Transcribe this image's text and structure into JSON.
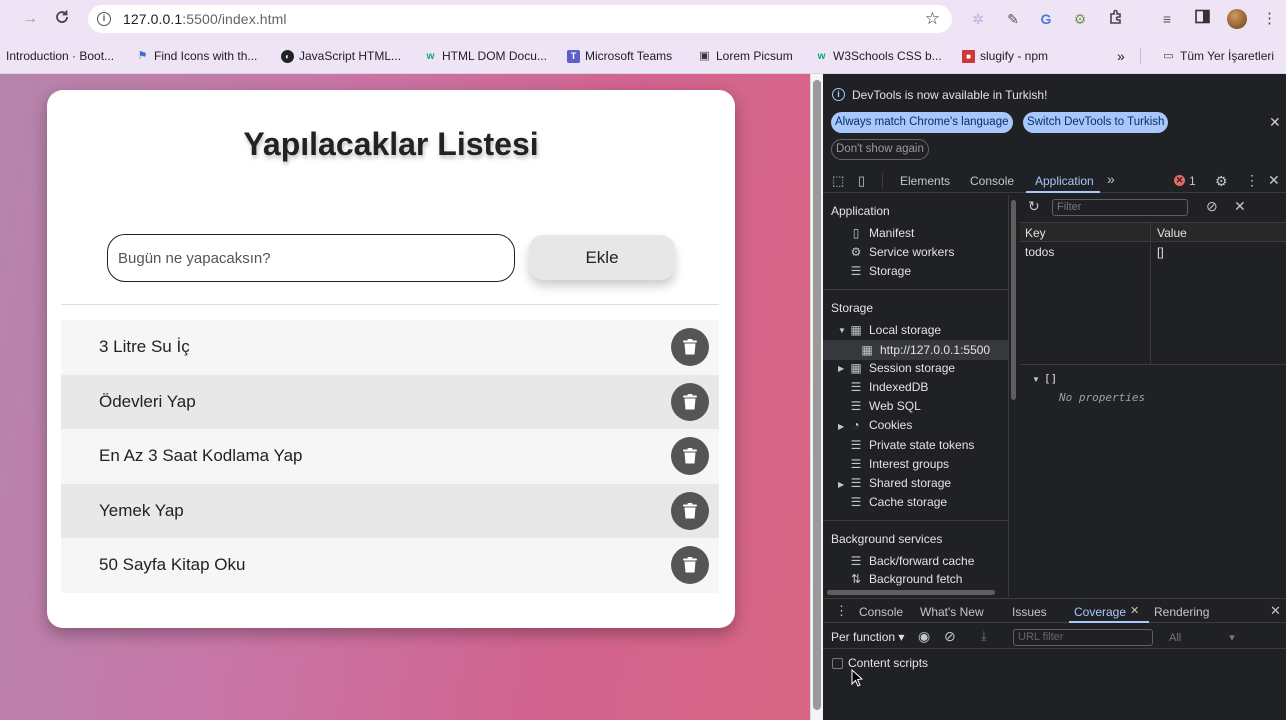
{
  "browser": {
    "url_host": "127.0.0.1",
    "url_rest": ":5500/index.html",
    "bookmarks": [
      {
        "label": "Introduction · Boot..."
      },
      {
        "label": "Find Icons with th..."
      },
      {
        "label": "JavaScript HTML..."
      },
      {
        "label": "HTML DOM Docu..."
      },
      {
        "label": "Microsoft Teams"
      },
      {
        "label": "Lorem Picsum"
      },
      {
        "label": "W3Schools CSS b..."
      },
      {
        "label": "slugify - npm"
      }
    ],
    "more_bookmarks": "»",
    "all_bookmarks": "Tüm Yer İşaretleri"
  },
  "app": {
    "title": "Yapılacaklar Listesi",
    "input_placeholder": "Bugün ne yapacaksın?",
    "add_label": "Ekle",
    "todos": [
      {
        "text": "3 Litre Su İç"
      },
      {
        "text": "Ödevleri Yap"
      },
      {
        "text": "En Az 3 Saat Kodlama Yap"
      },
      {
        "text": "Yemek Yap"
      },
      {
        "text": "50 Sayfa Kitap Oku"
      }
    ]
  },
  "devtools": {
    "banner": {
      "message": "DevTools is now available in Turkish!",
      "match_label": "Always match Chrome's language",
      "switch_label": "Switch DevTools to Turkish",
      "dont_show_label": "Don't show again"
    },
    "tabs": {
      "elements": "Elements",
      "console": "Console",
      "application": "Application",
      "more": "»",
      "error_count": "1"
    },
    "sidebar": {
      "application_header": "Application",
      "manifest": "Manifest",
      "service_workers": "Service workers",
      "storage_item": "Storage",
      "storage_header": "Storage",
      "local_storage": "Local storage",
      "local_origin": "http://127.0.0.1:5500",
      "session_storage": "Session storage",
      "indexeddb": "IndexedDB",
      "websql": "Web SQL",
      "cookies": "Cookies",
      "private_state": "Private state tokens",
      "interest_groups": "Interest groups",
      "shared_storage": "Shared storage",
      "cache_storage": "Cache storage",
      "background_header": "Background services",
      "bfcache": "Back/forward cache",
      "bg_fetch": "Background fetch"
    },
    "storage": {
      "filter_placeholder": "Filter",
      "key_header": "Key",
      "value_header": "Value",
      "row_key": "todos",
      "row_value": "[]",
      "preview_value": "[]",
      "no_properties": "No properties"
    },
    "drawer": {
      "console": "Console",
      "whats_new": "What's New",
      "issues": "Issues",
      "coverage": "Coverage",
      "rendering": "Rendering",
      "per_function": "Per function",
      "url_filter": "URL filter",
      "all": "All",
      "content_scripts": "Content scripts"
    }
  }
}
